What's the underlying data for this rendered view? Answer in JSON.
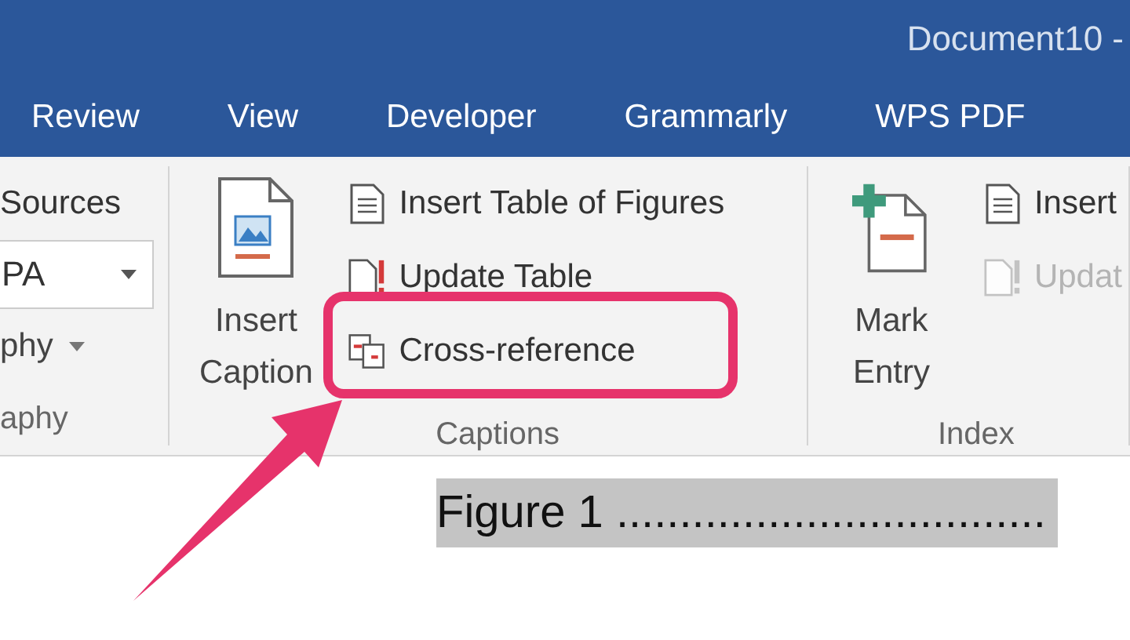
{
  "title_bar": {
    "title": "Document10 -"
  },
  "tabs": [
    {
      "label": "Review",
      "selected": false
    },
    {
      "label": "View",
      "selected": false
    },
    {
      "label": "Developer",
      "selected": false
    },
    {
      "label": "Grammarly",
      "selected": false
    },
    {
      "label": "WPS PDF",
      "selected": false
    }
  ],
  "ribbon": {
    "groups": [
      {
        "label": "aphy",
        "small": [
          {
            "kind": "text",
            "label": "Sources"
          },
          {
            "kind": "dropdown",
            "label": "PA"
          },
          {
            "kind": "menu",
            "label": "phy"
          }
        ]
      },
      {
        "label": "Captions",
        "large": [
          {
            "label": "Insert Caption"
          }
        ],
        "small": [
          {
            "kind": "button",
            "label": "Insert Table of Figures",
            "disabled": false
          },
          {
            "kind": "button",
            "label": "Update Table",
            "disabled": false
          },
          {
            "kind": "button",
            "label": "Cross-reference",
            "disabled": false
          }
        ]
      },
      {
        "label": "Index",
        "large": [
          {
            "label": "Mark Entry"
          }
        ],
        "small": [
          {
            "kind": "button",
            "label": "Insert",
            "disabled": false
          },
          {
            "kind": "button",
            "label": "Updat",
            "disabled": true
          }
        ]
      }
    ]
  },
  "document": {
    "lines": [
      {
        "text": "Figure 1 ..................................",
        "highlighted": true
      }
    ]
  }
}
